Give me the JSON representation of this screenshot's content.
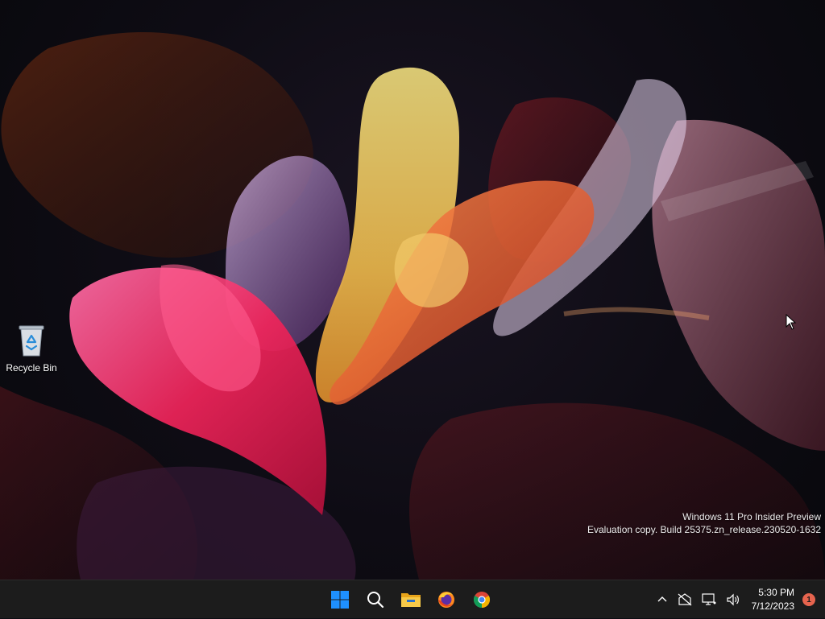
{
  "desktop": {
    "icons": [
      {
        "label": "Recycle Bin",
        "icon": "recycle-bin-icon"
      }
    ],
    "watermark": {
      "line1": "Windows 11 Pro Insider Preview",
      "line2": "Evaluation copy. Build 25375.zn_release.230520-1632"
    }
  },
  "taskbar": {
    "apps": [
      {
        "icon": "windows-start-icon"
      },
      {
        "icon": "search-icon"
      },
      {
        "icon": "file-explorer-icon"
      },
      {
        "icon": "firefox-icon"
      },
      {
        "icon": "chrome-icon"
      }
    ],
    "tray": {
      "icons": [
        "chevron-up-icon",
        "network-disconnected-icon",
        "display-icon",
        "volume-icon"
      ],
      "time": "5:30 PM",
      "date": "7/12/2023",
      "notification_count": "1"
    }
  },
  "colors": {
    "taskbar_bg": "#1c1c1c",
    "start_blue": "#1e90ff",
    "notification_badge": "#e6644e"
  }
}
